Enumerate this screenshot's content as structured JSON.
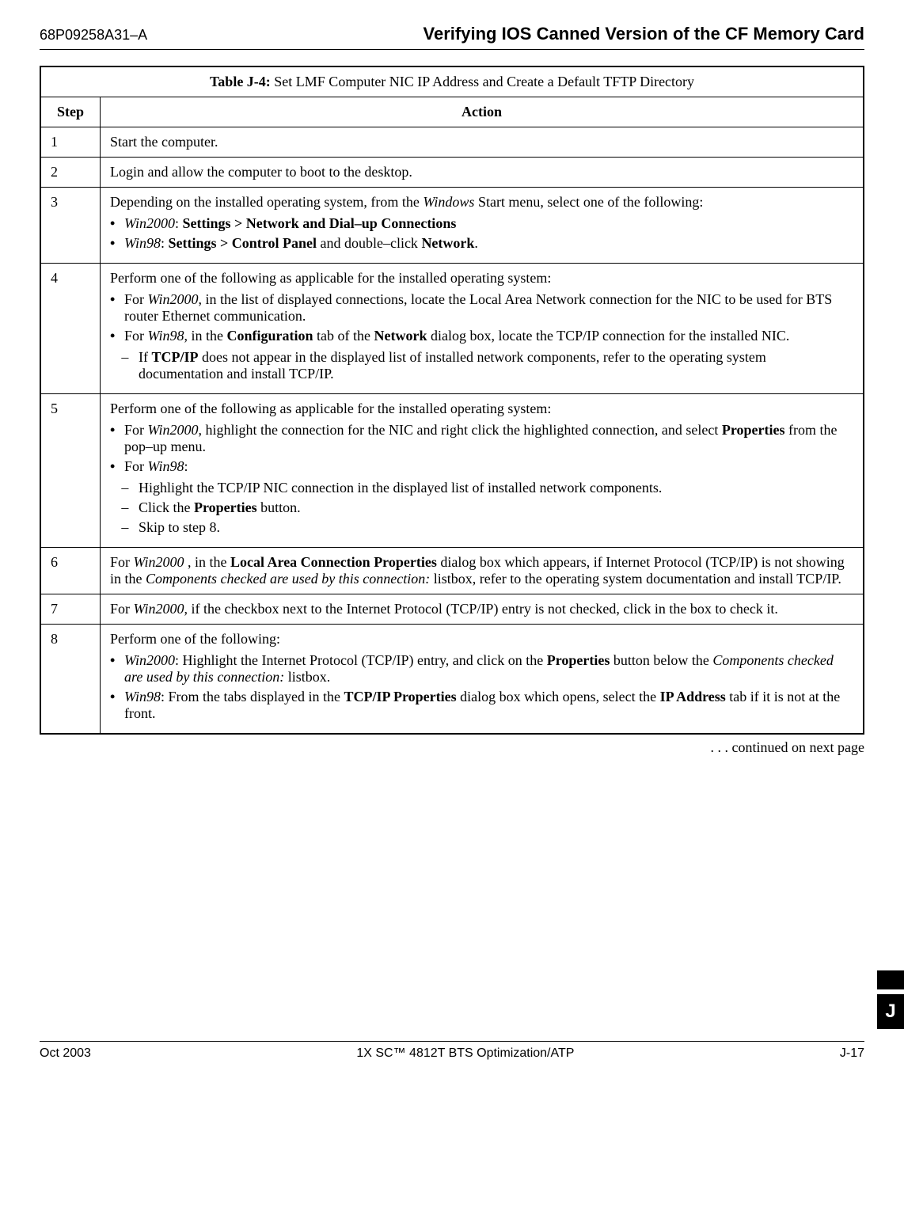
{
  "header": {
    "docId": "68P09258A31–A",
    "title": "Verifying IOS Canned Version of the CF Memory Card"
  },
  "table": {
    "labelPrefix": "Table J-4:",
    "labelText": " Set LMF Computer NIC IP Address and Create a Default TFTP Directory",
    "stepHeader": "Step",
    "actionHeader": "Action",
    "rows": {
      "r1": {
        "num": "1",
        "text": "Start the computer."
      },
      "r2": {
        "num": "2",
        "text": "Login and allow the computer to boot to the desktop."
      },
      "r3": {
        "num": "3",
        "intro_a": "Depending on the installed operating system, from the ",
        "intro_b": "Windows",
        "intro_c": " Start menu, select one of the following:",
        "b1_a": "Win2000",
        "b1_b": ": ",
        "b1_c": "Settings > Network and Dial–up Connections",
        "b2_a": "Win98",
        "b2_b": ": ",
        "b2_c": "Settings > Control Panel",
        "b2_d": " and double–click  ",
        "b2_e": "Network",
        "b2_f": "."
      },
      "r4": {
        "num": "4",
        "intro": "Perform one of the following as applicable for the installed operating system:",
        "b1_a": "For ",
        "b1_b": "Win2000",
        "b1_c": ", in the list of displayed connections, locate the Local Area Network connection for the NIC to be used for BTS router Ethernet communication.",
        "b2_a": "For ",
        "b2_b": "Win98",
        "b2_c": ", in the ",
        "b2_d": "Configuration",
        "b2_e": " tab of the ",
        "b2_f": "Network",
        "b2_g": " dialog box, locate the TCP/IP connection for the installed NIC.",
        "d1_a": "If ",
        "d1_b": "TCP/IP",
        "d1_c": " does not appear in the displayed list of installed network components, refer to the operating system documentation and install TCP/IP."
      },
      "r5": {
        "num": "5",
        "intro": "Perform one of the following as applicable for the installed operating system:",
        "b1_a": "For ",
        "b1_b": "Win2000",
        "b1_c": ",  highlight the connection for the NIC and right click the highlighted connection, and select ",
        "b1_d": "Properties",
        "b1_e": " from the pop–up menu.",
        "b2_a": "For ",
        "b2_b": "Win98",
        "b2_c": ":",
        "d1": "Highlight the TCP/IP NIC connection in the displayed list of installed network components.",
        "d2_a": "Click the ",
        "d2_b": "Properties",
        "d2_c": " button.",
        "d3_a": "Skip to step ",
        "d3_b": "8",
        "d3_c": "."
      },
      "r6": {
        "num": "6",
        "a": "For ",
        "b": "Win2000",
        "c": " , in the ",
        "d": "Local Area Connection Properties",
        "e": " dialog box which appears, if Internet Protocol (TCP/IP) is not showing in the ",
        "f": "Components checked are used by this connection:",
        "g": " listbox, refer to the operating system documentation and install TCP/IP."
      },
      "r7": {
        "num": "7",
        "a": "For ",
        "b": "Win2000",
        "c": ", if the checkbox next to the Internet Protocol (TCP/IP) entry is not checked, click in the box to check it."
      },
      "r8": {
        "num": "8",
        "intro": "Perform one of the following:",
        "b1_a": "Win2000",
        "b1_b": ": Highlight the Internet Protocol (TCP/IP) entry, and click on the ",
        "b1_c": "Properties",
        "b1_d": " button below the ",
        "b1_e": "Components checked are used by this connection:",
        "b1_f": " listbox.",
        "b2_a": "Win98",
        "b2_b": ": From the tabs displayed in the ",
        "b2_c": "TCP/IP Properties",
        "b2_d": " dialog box which opens, select the ",
        "b2_e": "IP Address",
        "b2_f": " tab if it is not at the front."
      }
    }
  },
  "continued": ". . . continued on next page",
  "footer": {
    "left": "Oct 2003",
    "center": "1X SC™ 4812T BTS Optimization/ATP",
    "right": "J-17",
    "tab": "J"
  }
}
